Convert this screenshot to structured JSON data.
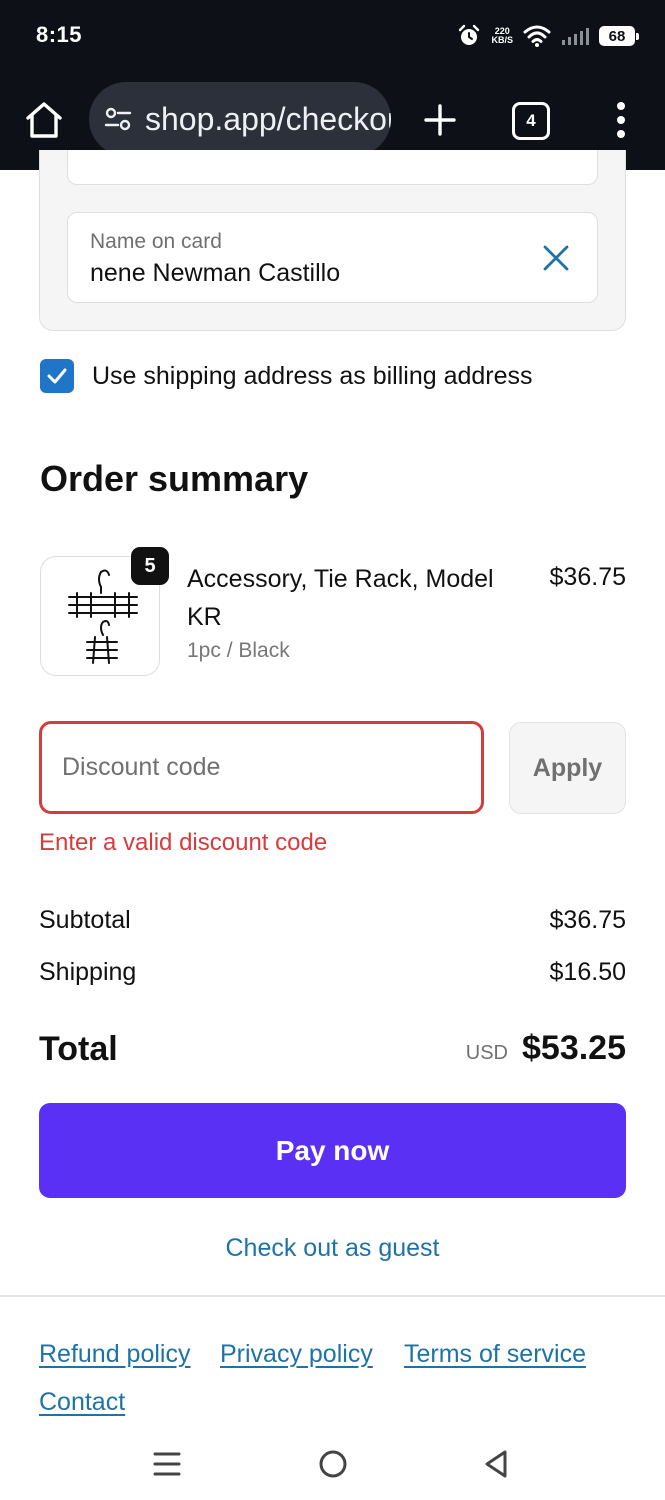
{
  "status_bar": {
    "time": "8:15",
    "net_speed_value": "220",
    "net_speed_unit": "KB/S",
    "battery": "68",
    "icons": [
      "alarm-icon",
      "wifi-icon",
      "signal-icon",
      "battery-icon"
    ]
  },
  "browser": {
    "url": "shop.app/checkouts",
    "tab_count": "4",
    "icons": [
      "home-icon",
      "site-settings-icon",
      "new-tab-plus-icon",
      "tab-switcher-icon",
      "more-vertical-icon"
    ]
  },
  "payment": {
    "name_label": "Name on card",
    "name_value": "nene Newman Castillo",
    "billing_checkbox_label": "Use shipping address as billing address",
    "billing_checked": true
  },
  "summary": {
    "title": "Order summary",
    "item": {
      "name": "Accessory, Tie Rack, Model KR",
      "variant": "1pc / Black",
      "price": "$36.75",
      "quantity": "5"
    },
    "discount": {
      "placeholder": "Discount code",
      "apply_label": "Apply",
      "error": "Enter a valid discount code"
    },
    "subtotal_label": "Subtotal",
    "subtotal_value": "$36.75",
    "shipping_label": "Shipping",
    "shipping_value": "$16.50",
    "total_label": "Total",
    "total_currency": "USD",
    "total_value": "$53.25"
  },
  "actions": {
    "pay_label": "Pay now",
    "guest_label": "Check out as guest"
  },
  "footer": {
    "refund": "Refund policy",
    "privacy": "Privacy policy",
    "terms": "Terms of service",
    "contact": "Contact"
  },
  "colors": {
    "pay_button": "#5a31f4",
    "link": "#1e73a6",
    "error": "#d53c3c",
    "checkbox": "#1f76c9"
  }
}
